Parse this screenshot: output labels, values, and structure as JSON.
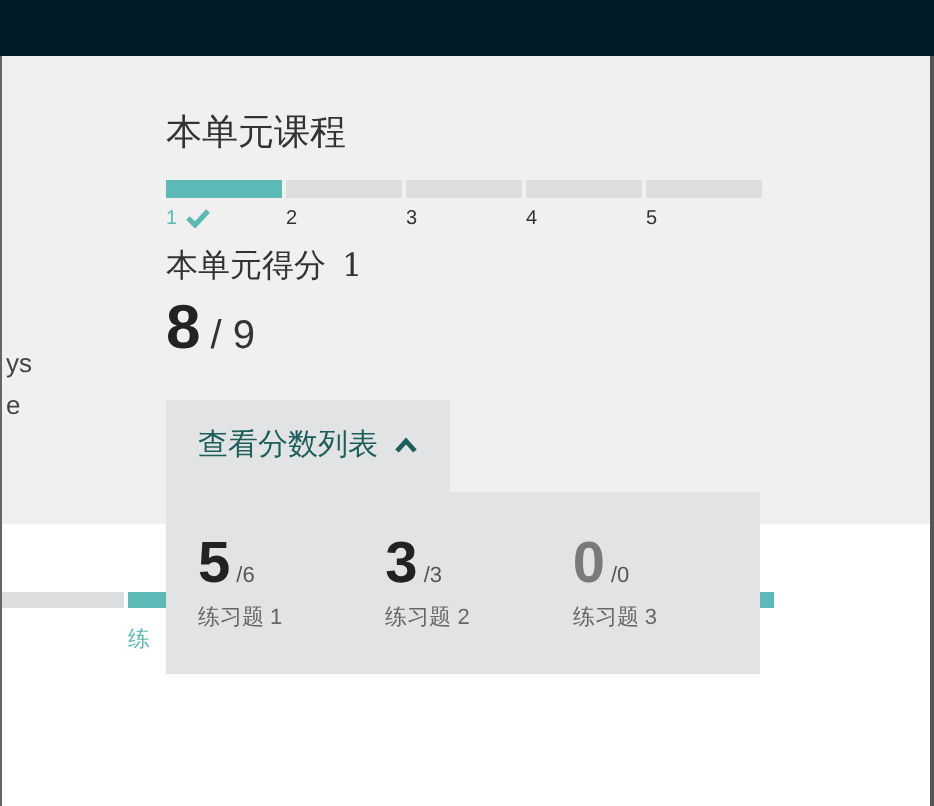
{
  "left_fragments": [
    "ys",
    "e"
  ],
  "course": {
    "title": "本单元课程",
    "steps": [
      {
        "label": "1",
        "done": true
      },
      {
        "label": "2",
        "done": false
      },
      {
        "label": "3",
        "done": false
      },
      {
        "label": "4",
        "done": false
      },
      {
        "label": "5",
        "done": false
      }
    ]
  },
  "score": {
    "title": "本单元得分",
    "footnote": "1",
    "value": "8",
    "total": "/ 9"
  },
  "lower_progress": {
    "segments": [
      {
        "done": false
      },
      {
        "done": true
      }
    ],
    "right_segment": {
      "done": true
    },
    "label": "练"
  },
  "score_list": {
    "toggle": "查看分数列表",
    "expanded": true,
    "items": [
      {
        "value": "5",
        "total": "/6",
        "label": "练习题 1",
        "dimmed": false
      },
      {
        "value": "3",
        "total": "/3",
        "label": "练习题 2",
        "dimmed": false
      },
      {
        "value": "0",
        "total": "/0",
        "label": "练习题 3",
        "dimmed": true
      }
    ]
  }
}
